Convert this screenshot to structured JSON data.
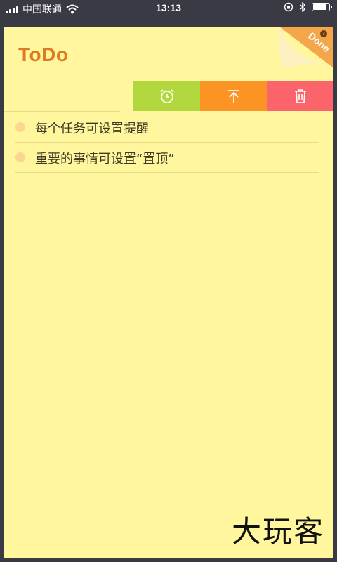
{
  "status_bar": {
    "carrier": "中国联通",
    "time": "13:13"
  },
  "app": {
    "title": "ToDo",
    "corner_label": "Done",
    "corner_badge": "?"
  },
  "swipe_actions": [
    {
      "name": "alarm",
      "icon": "alarm-clock-icon",
      "color": "#b2d83e"
    },
    {
      "name": "pin-top",
      "icon": "pin-top-icon",
      "color": "#fb9425"
    },
    {
      "name": "delete",
      "icon": "trash-icon",
      "color": "#fb646a"
    }
  ],
  "tasks": [
    {
      "text": "每个任务可设置提醒"
    },
    {
      "text": "重要的事情可设置“置顶”"
    }
  ],
  "watermark": "大玩客",
  "colors": {
    "note_background": "#fff69e",
    "title": "#e07a22",
    "bullet": "#fad690"
  }
}
